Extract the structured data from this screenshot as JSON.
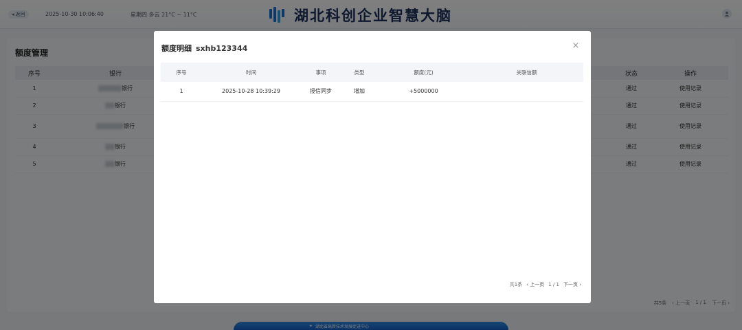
{
  "topbar": {
    "back_label": "返回",
    "datetime": "2025-10-30  10:06:40",
    "weather": "星期四  多云  21°C ~ 11°C",
    "brand_title": "湖北科创企业智慧大脑"
  },
  "page": {
    "title": "额度管理",
    "columns": {
      "index": "序号",
      "bank": "银行",
      "status": "状态",
      "action": "操作"
    },
    "rows": [
      {
        "index": "1",
        "bank": "银行",
        "status": "通过",
        "action": "使用记录"
      },
      {
        "index": "2",
        "bank": "银行",
        "status": "通过",
        "action": "使用记录"
      },
      {
        "index": "3",
        "bank": "银行",
        "status": "通过",
        "action": "使用记录"
      },
      {
        "index": "4",
        "bank": "银行",
        "status": "通过",
        "action": "使用记录"
      },
      {
        "index": "5",
        "bank": "银行",
        "status": "通过",
        "action": "使用记录"
      }
    ],
    "pager": {
      "total": "共5条",
      "prev": "‹ 上一页",
      "page": "1 / 1",
      "next": "下一页 ›"
    }
  },
  "footer": {
    "text": "湖北省高新技术发展促进中心"
  },
  "modal": {
    "title": "额度明细",
    "code": "sxhb123344",
    "close": "×",
    "columns": {
      "index": "序号",
      "time": "时间",
      "item": "事项",
      "type": "类型",
      "amount": "额度(元)",
      "related": "关联信额"
    },
    "rows": [
      {
        "index": "1",
        "time": "2025-10-28 10:39:29",
        "item": "授信同步",
        "type": "增加",
        "amount": "+5000000",
        "related": ""
      }
    ],
    "pager": {
      "total": "共1条",
      "prev": "‹ 上一页",
      "page": "1 / 1",
      "next": "下一页 ›"
    }
  },
  "colors": {
    "amount_positive": "#52c41a",
    "link": "#2f6fd0",
    "brand": "#1a2f5c"
  },
  "icons": {
    "back": "arrow-left-icon",
    "user": "user-icon",
    "close": "close-icon",
    "logo": "brand-logo-icon"
  }
}
